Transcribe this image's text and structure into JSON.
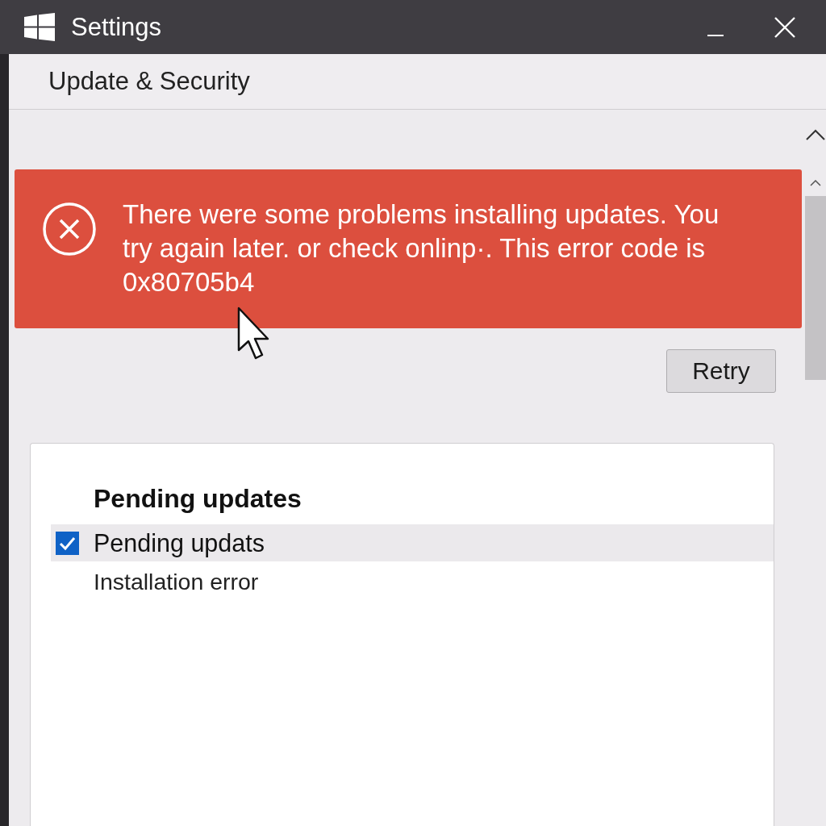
{
  "window": {
    "title": "Settings"
  },
  "header": {
    "title": "Update & Security"
  },
  "error_banner": {
    "message": "There were some problems installing updates. You try again later. or check onlinp·. This error code is 0x80705b4"
  },
  "retry_button": {
    "label": "Retry"
  },
  "pending_card": {
    "title": "Pending updates",
    "items": [
      {
        "label": "Pending updats",
        "checked": true,
        "selected": true,
        "detail": "Installation error"
      }
    ]
  }
}
